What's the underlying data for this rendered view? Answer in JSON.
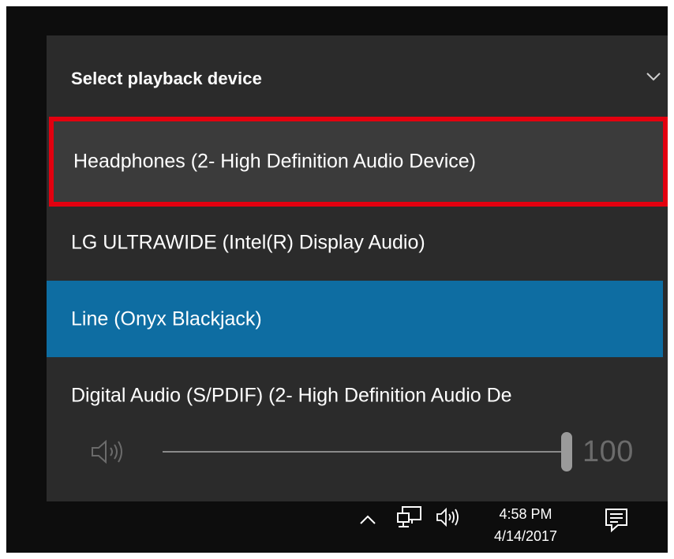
{
  "flyout": {
    "title": "Select playback device",
    "title_icon": "chevron-down-icon",
    "devices": [
      {
        "label": "Headphones (2- High Definition Audio Device)",
        "state": "hover-highlighted"
      },
      {
        "label": "LG ULTRAWIDE (Intel(R) Display Audio)",
        "state": "normal"
      },
      {
        "label": "Line (Onyx Blackjack)",
        "state": "selected"
      },
      {
        "label": "Digital Audio (S/PDIF) (2- High Definition Audio De",
        "state": "normal"
      }
    ],
    "volume": {
      "icon": "speaker-icon",
      "value": "100",
      "level_percent": 100
    }
  },
  "taskbar": {
    "icons": [
      "chevron-up-icon",
      "network-icon",
      "speaker-icon",
      "notification-icon"
    ],
    "time": "4:58 PM",
    "date": "4/14/2017"
  },
  "colors": {
    "flyout_bg": "#2b2b2b",
    "hover_bg": "#3b3b3b",
    "selected_bg": "#0e6da2",
    "highlight_border": "#e3000f",
    "taskbar_bg": "#0d0d0d"
  }
}
